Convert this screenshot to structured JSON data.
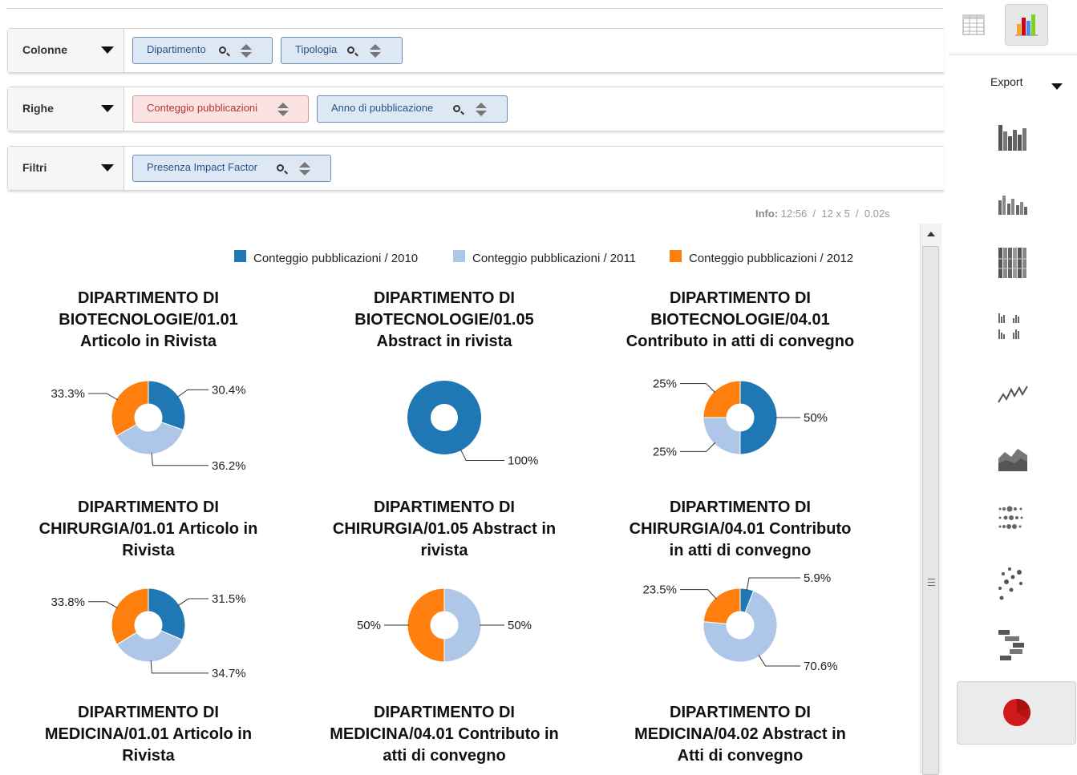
{
  "shelves": {
    "columns": {
      "label": "Colonne",
      "chips": [
        "Dipartimento",
        "Tipologia"
      ]
    },
    "rows": {
      "label": "Righe",
      "chips": [
        "Conteggio pubblicazioni",
        "Anno di pubblicazione"
      ]
    },
    "filters": {
      "label": "Filtri",
      "chips": [
        "Presenza Impact Factor"
      ]
    }
  },
  "info": {
    "label": "Info:",
    "time": "12:56",
    "size": "12 x 5",
    "duration": "0.02s"
  },
  "toolbar": {
    "export_label": "Export",
    "icons": [
      "table-icon",
      "bar-chart-icon",
      "stacked-bar-icon",
      "bar-icon",
      "column-100-icon",
      "multiple-bars-icon",
      "line-icon",
      "area-icon",
      "dot-icon",
      "scatter-icon",
      "waterfall-icon",
      "pie-icon"
    ]
  },
  "colors": {
    "y2010": "#1f77b4",
    "y2011": "#aec7e8",
    "y2012": "#ff7f0e"
  },
  "chart_data": {
    "type": "pie",
    "legend": [
      "Conteggio pubblicazioni / 2010",
      "Conteggio pubblicazioni / 2011",
      "Conteggio pubblicazioni / 2012"
    ],
    "legend_position": "top",
    "charts": [
      {
        "title": [
          "DIPARTIMENTO DI",
          "BIOTECNOLOGIE/01.01",
          "Articolo in Rivista"
        ],
        "values": [
          30.4,
          36.2,
          33.3
        ],
        "labels": [
          "30.4%",
          "36.2%",
          "33.3%"
        ]
      },
      {
        "title": [
          "DIPARTIMENTO DI",
          "BIOTECNOLOGIE/01.05",
          "Abstract in rivista"
        ],
        "values": [
          100,
          0,
          0
        ],
        "labels": [
          "100%",
          "",
          ""
        ]
      },
      {
        "title": [
          "DIPARTIMENTO DI",
          "BIOTECNOLOGIE/04.01",
          "Contributo in atti di convegno"
        ],
        "values": [
          50,
          25,
          25
        ],
        "labels": [
          "50%",
          "25%",
          "25%"
        ]
      },
      {
        "title": [
          "DIPARTIMENTO DI",
          "CHIRURGIA/01.01 Articolo in",
          "Rivista"
        ],
        "values": [
          31.5,
          34.7,
          33.8
        ],
        "labels": [
          "31.5%",
          "34.7%",
          "33.8%"
        ]
      },
      {
        "title": [
          "DIPARTIMENTO DI",
          "CHIRURGIA/01.05 Abstract in",
          "rivista"
        ],
        "values": [
          0,
          50,
          50
        ],
        "labels": [
          "",
          "50%",
          "50%"
        ]
      },
      {
        "title": [
          "DIPARTIMENTO DI",
          "CHIRURGIA/04.01 Contributo",
          "in atti di convegno"
        ],
        "values": [
          5.9,
          70.6,
          23.5
        ],
        "labels": [
          "5.9%",
          "70.6%",
          "23.5%"
        ]
      },
      {
        "title": [
          "DIPARTIMENTO DI",
          "MEDICINA/01.01 Articolo in",
          "Rivista"
        ],
        "values": [],
        "labels": []
      },
      {
        "title": [
          "DIPARTIMENTO DI",
          "MEDICINA/04.01 Contributo in",
          "atti di convegno"
        ],
        "values": [],
        "labels": []
      },
      {
        "title": [
          "DIPARTIMENTO DI",
          "MEDICINA/04.02 Abstract in",
          "Atti di convegno"
        ],
        "values": [],
        "labels": []
      }
    ]
  }
}
